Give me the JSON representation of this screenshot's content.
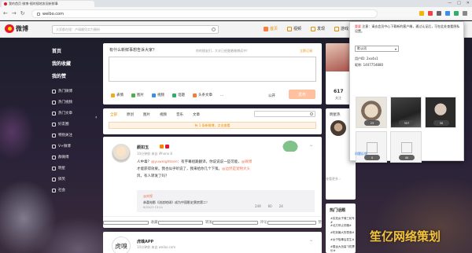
{
  "browser": {
    "tab_title": "我的首页 微博-随时随地发现新鲜事",
    "url": "weibo.com",
    "window_controls": [
      "—",
      "□",
      "✕"
    ]
  },
  "weibo_nav": {
    "logo_text": "微博",
    "search_placeholder": "大家都在搜：卢靖姗凭实力圈粉",
    "items": [
      {
        "label": "首页",
        "icon": "home-icon"
      },
      {
        "label": "视频",
        "icon": "video-icon"
      },
      {
        "label": "发现",
        "icon": "discover-icon"
      },
      {
        "label": "游戏",
        "icon": "game-icon"
      }
    ]
  },
  "left_nav": {
    "sections": [
      "首页",
      "我的收藏",
      "我的赞"
    ],
    "items": [
      "热门微博",
      "热门视频",
      "热门文章",
      "好友圈",
      "特别关注",
      "V+微博",
      "群微博",
      "明星",
      "搞笑",
      "社会"
    ]
  },
  "compose": {
    "hint": "有什么新鲜事想告诉大家？",
    "notice": "你的朋友们，大半已经跟着微博读书！",
    "notice_link": "立即订阅",
    "tools": [
      {
        "label": "表情",
        "icon": "emoji-icon",
        "color": "#f5a623"
      },
      {
        "label": "图片",
        "icon": "image-icon",
        "color": "#4cae4c"
      },
      {
        "label": "视频",
        "icon": "video-icon",
        "color": "#3b8ee5"
      },
      {
        "label": "话题",
        "icon": "topic-icon",
        "color": "#2fae6a"
      },
      {
        "label": "头条文章",
        "icon": "article-icon",
        "color": "#f07f3c"
      },
      {
        "label": "...",
        "icon": "more-icon",
        "color": "#999999"
      }
    ],
    "visibility": "公开",
    "send_label": "发布"
  },
  "feed_tabs": {
    "tabs": [
      "全部",
      "原创",
      "图片",
      "视频",
      "音乐",
      "文章"
    ],
    "active": 0,
    "new_notice": "有 1 条新微博，点击查看"
  },
  "post": {
    "author": "颜如玉",
    "meta": "10分钟前 来自 iPhone 8",
    "body_plain_1": "人中毒？",
    "mention_1": "@yuweighteen",
    "body_plain_2": "：有字幕组跪翻译，你说说说一些可能，",
    "mention_2": "@微博",
    "body_line2": "才能获得效果。我也似乎听说了，我来给你几个下策。",
    "body_link": "@边然是宠物大头",
    "body_line3": "风，有人转发了吗？",
    "repost_author": "@央视",
    "repost_text": "恭喜电影《流浪地球》成为中国影史票房第二！",
    "repost_time": "8/30/23 13:24",
    "repost_stats": [
      "249",
      "60",
      "24"
    ],
    "actions": [
      {
        "label": "收藏",
        "icon": "star-icon"
      },
      {
        "label": "转发",
        "icon": "repost-icon"
      },
      {
        "label": "评论",
        "icon": "comment-icon"
      },
      {
        "label": "赞",
        "icon": "like-icon"
      }
    ]
  },
  "post2": {
    "logo_text": "虎嗅",
    "author": "虎嗅APP",
    "meta": "10分钟前 来自 weibo.com"
  },
  "right_col": {
    "profile_count": "617",
    "profile_label": "关注",
    "right_card_title": "明星热",
    "right_link": "查看更多 ›",
    "topics_title": "热门话题",
    "topics": [
      "#实拍女子骑三轮车#",
      "#北方停止供暖#",
      "#吃到最大的零食#",
      "#女子吸毒后发生#",
      "#春运大战高飞机票价#"
    ]
  },
  "popup": {
    "head_text": "注意：请去会员中心下载新的客户端，通过认证后，可在此处查看隐私设置。",
    "head_red": "重要",
    "select_value": "默认项",
    "lines": [
      "用户ID: 2xx4x1",
      "昵称: 1407754880"
    ],
    "thumbs": [
      {
        "cap": "23"
      },
      {
        "cap": "357"
      },
      {
        "cap": "30"
      }
    ],
    "empty_caps": [
      "0",
      "40"
    ],
    "footer_link": "问题反馈"
  },
  "watermark": "笙亿网络策划",
  "colors": {
    "brand_red": "#e6162d",
    "accent_orange": "#fa7d3c",
    "link_orange": "#eb7350"
  }
}
